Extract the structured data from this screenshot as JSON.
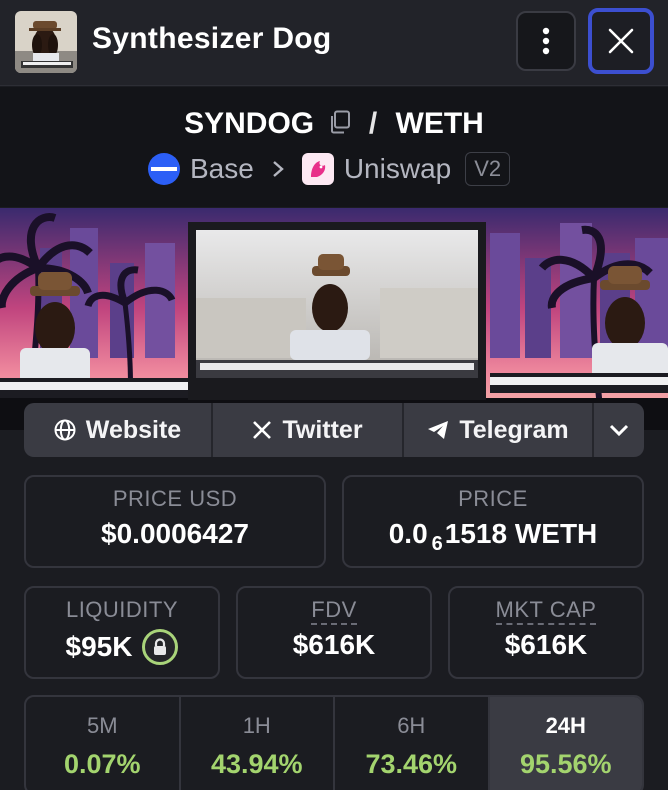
{
  "header": {
    "title": "Synthesizer Dog",
    "more_icon": "vertical-dots-icon",
    "close_icon": "close-icon"
  },
  "pair": {
    "base_token": "SYNDOG",
    "separator": "/",
    "quote_token": "WETH",
    "chain": "Base",
    "chain_color": "#2c5ff6",
    "dex": "Uniswap",
    "dex_version": "V2"
  },
  "links": [
    {
      "label": "Website",
      "icon": "globe-icon"
    },
    {
      "label": "Twitter",
      "icon": "x-logo-icon"
    },
    {
      "label": "Telegram",
      "icon": "telegram-icon"
    }
  ],
  "stats": {
    "price_usd_label": "PRICE USD",
    "price_usd": "$0.0006427",
    "price_label": "PRICE",
    "price_prefix": "0.0",
    "price_zeros": "6",
    "price_rest": "1518 WETH",
    "liquidity_label": "LIQUIDITY",
    "liquidity": "$95K",
    "fdv_label": "FDV",
    "fdv": "$616K",
    "mktcap_label": "MKT CAP",
    "mktcap": "$616K"
  },
  "changes": [
    {
      "label": "5M",
      "value": "0.07%"
    },
    {
      "label": "1H",
      "value": "43.94%"
    },
    {
      "label": "6H",
      "value": "73.46%"
    },
    {
      "label": "24H",
      "value": "95.56%",
      "active": true
    }
  ],
  "colors": {
    "positive": "#a3d46e",
    "accent_focus": "#3c4fd0"
  }
}
